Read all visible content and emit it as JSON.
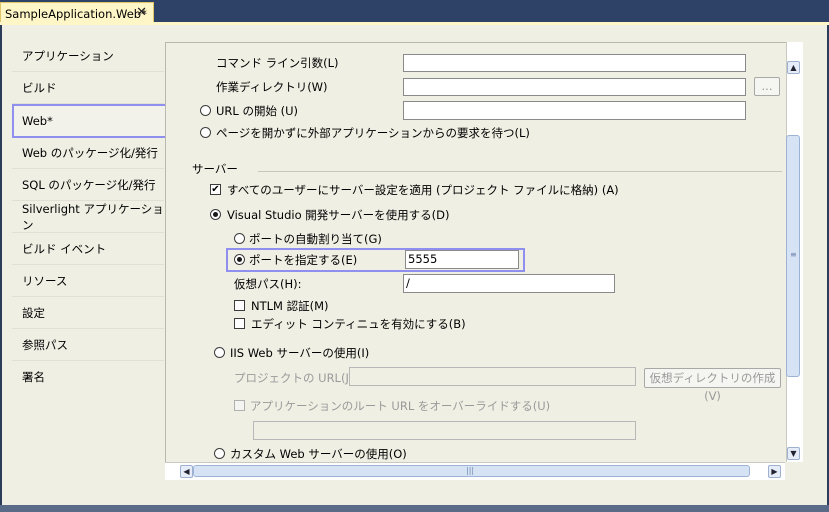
{
  "document_tab": {
    "title": "SampleApplication.Web*",
    "close": "✕"
  },
  "sidebar": {
    "items": [
      {
        "label": "アプリケーション"
      },
      {
        "label": "ビルド"
      },
      {
        "label": "Web*"
      },
      {
        "label": "Web のパッケージ化/発行"
      },
      {
        "label": "SQL のパッケージ化/発行"
      },
      {
        "label": "Silverlight アプリケーション"
      },
      {
        "label": "ビルド イベント"
      },
      {
        "label": "リソース"
      },
      {
        "label": "設定"
      },
      {
        "label": "参照パス"
      },
      {
        "label": "署名"
      }
    ],
    "selected_index": 2
  },
  "start_action": {
    "command_line_label": "コマンド ライン引数(L)",
    "command_line_value": "",
    "working_dir_label": "作業ディレクトリ(W)",
    "working_dir_value": "",
    "browse_label": "...",
    "start_url_label": "URL の開始 (U)",
    "start_url_value": "",
    "wait_external_label": "ページを開かずに外部アプリケーションからの要求を待つ(L)"
  },
  "servers": {
    "section_label": "サーバー",
    "apply_all_users_label": "すべてのユーザーにサーバー設定を適用 (プロジェクト ファイルに格納) (A)",
    "apply_all_users_checked": true,
    "vs_dev_server_label": "Visual Studio 開発サーバーを使用する(D)",
    "auto_port_label": "ポートの自動割り当て(G)",
    "specific_port_label": "ポートを指定する(E)",
    "specific_port_value": "5555",
    "virtual_path_label": "仮想パス(H):",
    "virtual_path_value": "/",
    "ntlm_label": "NTLM 認証(M)",
    "edit_continue_label": "エディット コンティニュを有効にする(B)",
    "iis_label": "IIS Web サーバーの使用(I)",
    "project_url_label": "プロジェクトの URL(J):",
    "project_url_value": "",
    "create_vdir_label": "仮想ディレクトリの作成(V)",
    "override_root_label": "アプリケーションのルート URL をオーバーライドする(U)",
    "override_root_value": "",
    "custom_server_label": "カスタム Web サーバーの使用(O)"
  },
  "scroll": {
    "up": "▲",
    "down": "▼",
    "left": "◀",
    "right": "▶",
    "grip_v": "≡",
    "grip_h": "|||"
  },
  "colors": {
    "highlight": "#8f8ff0",
    "tab_active": "#fff6c8",
    "chrome": "#2e4166"
  }
}
